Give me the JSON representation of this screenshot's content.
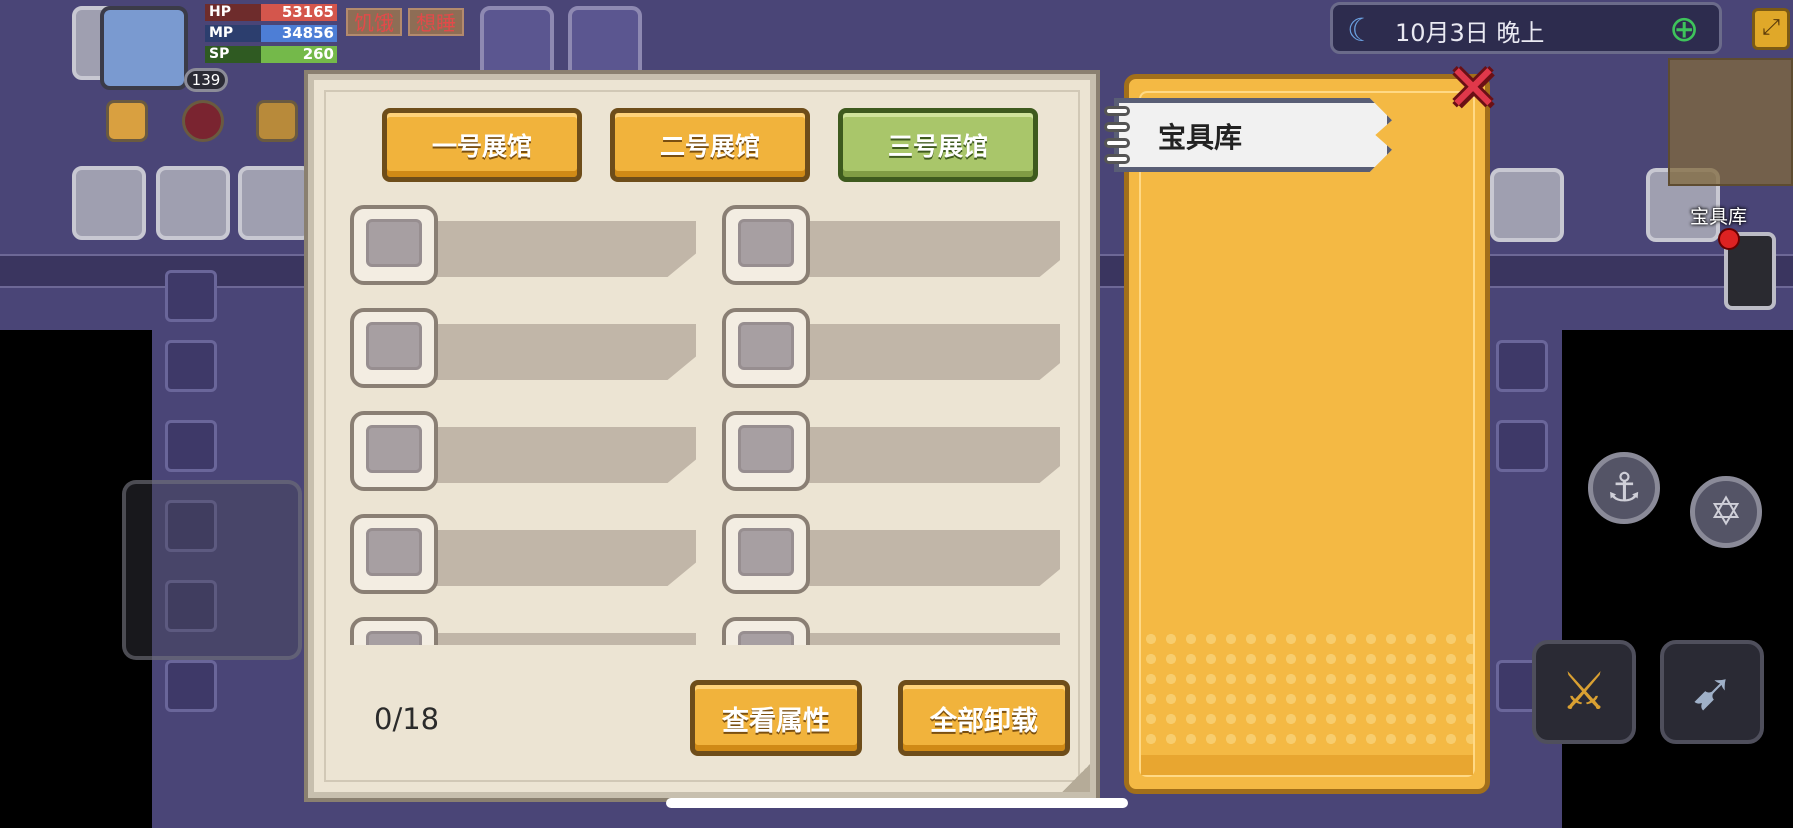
{
  "hud": {
    "stats": [
      {
        "label": "HP",
        "value": "53165",
        "color": "#d4564c"
      },
      {
        "label": "MP",
        "value": "34856",
        "color": "#4d7ed6"
      },
      {
        "label": "SP",
        "value": "260",
        "color": "#74b94a"
      }
    ],
    "status_tags": [
      "饥饿",
      "想睡"
    ],
    "level": "139",
    "date_time": "10月3日 晚上",
    "map_label": "宝具库"
  },
  "museum": {
    "tabs": [
      {
        "label": "一号展馆",
        "active": false
      },
      {
        "label": "二号展馆",
        "active": false
      },
      {
        "label": "三号展馆",
        "active": true
      }
    ],
    "count": "0/18",
    "buttons": {
      "view_attributes": "查看属性",
      "unload_all": "全部卸载"
    }
  },
  "vault": {
    "title": "宝具库"
  },
  "icons": {
    "close": "close-icon",
    "moon": "moon-icon",
    "globe": "globe-icon",
    "minimap_toggle": "minimap-toggle-icon",
    "phone": "phone-icon"
  },
  "colors": {
    "tab_default": "#f1b33c",
    "tab_active": "#a9c66a",
    "panel_bg": "#ece4d3",
    "vault_bg": "#f4b944",
    "close_red": "#e0384a"
  }
}
